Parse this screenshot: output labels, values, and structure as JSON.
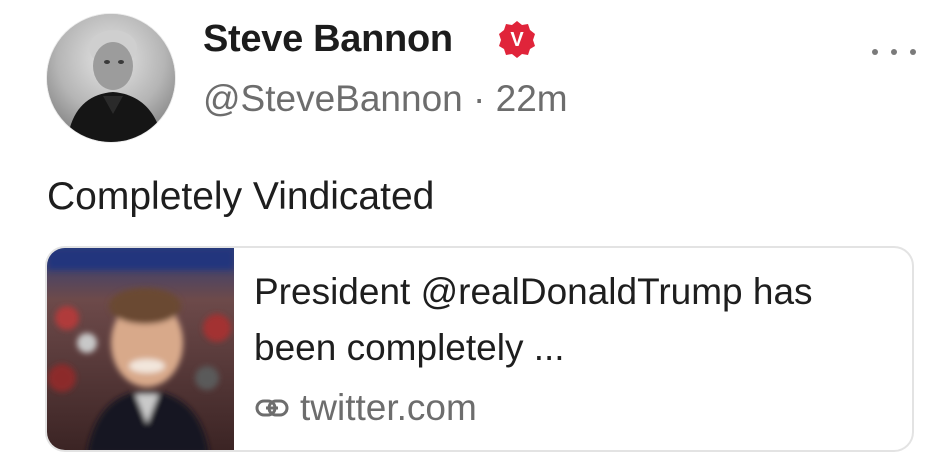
{
  "post": {
    "author": {
      "display_name": "Steve Bannon",
      "verified_badge": "V",
      "verified_color": "#e0243a",
      "handle": "@SteveBannon",
      "separator": "·",
      "time": "22m"
    },
    "more_icon": "more-horizontal-icon",
    "text": "Completely Vindicated",
    "link_card": {
      "title": "President @realDonaldTrump has been completely ...",
      "link_icon": "link-icon",
      "domain": "twitter.com"
    }
  }
}
